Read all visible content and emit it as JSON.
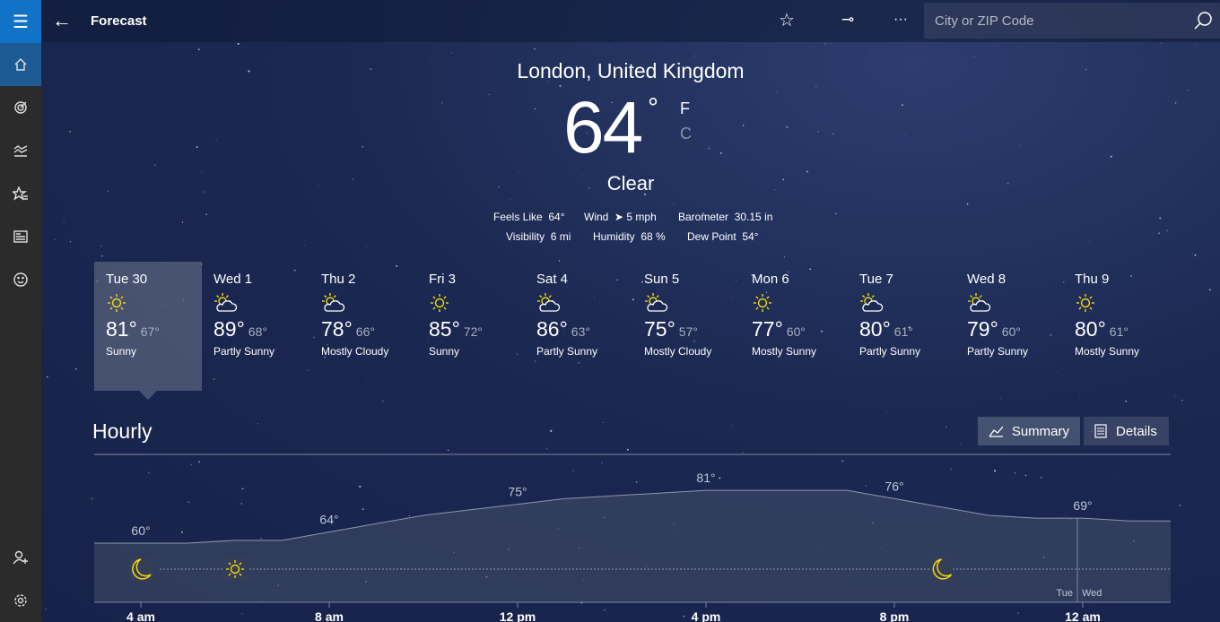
{
  "app": {
    "title": "Forecast",
    "search_placeholder": "City or ZIP Code"
  },
  "sidebar": {
    "items": [
      "menu-icon",
      "home-icon",
      "radar-icon",
      "historical-icon",
      "favorites-icon",
      "news-icon",
      "feedback-icon",
      "account-icon",
      "settings-icon"
    ]
  },
  "current": {
    "location": "London, United Kingdom",
    "temp": "64",
    "deg": "°",
    "unit_f": "F",
    "unit_c": "C",
    "condition": "Clear",
    "details": [
      {
        "label": "Feels Like",
        "value": "64°"
      },
      {
        "label": "Wind",
        "value": "5 mph"
      },
      {
        "label": "Barometer",
        "value": "30.15 in"
      },
      {
        "label": "Visibility",
        "value": "6 mi"
      },
      {
        "label": "Humidity",
        "value": "68 %"
      },
      {
        "label": "Dew Point",
        "value": "54°"
      }
    ]
  },
  "daily": [
    {
      "day": "Tue 30",
      "hi": "81°",
      "lo": "67°",
      "cond": "Sunny",
      "icon": "sun"
    },
    {
      "day": "Wed 1",
      "hi": "89°",
      "lo": "68°",
      "cond": "Partly Sunny",
      "icon": "partly"
    },
    {
      "day": "Thu 2",
      "hi": "78°",
      "lo": "66°",
      "cond": "Mostly Cloudy",
      "icon": "partly"
    },
    {
      "day": "Fri 3",
      "hi": "85°",
      "lo": "72°",
      "cond": "Sunny",
      "icon": "sun"
    },
    {
      "day": "Sat 4",
      "hi": "86°",
      "lo": "63°",
      "cond": "Partly Sunny",
      "icon": "partly"
    },
    {
      "day": "Sun 5",
      "hi": "75°",
      "lo": "57°",
      "cond": "Mostly Cloudy",
      "icon": "partly"
    },
    {
      "day": "Mon 6",
      "hi": "77°",
      "lo": "60°",
      "cond": "Mostly Sunny",
      "icon": "sun"
    },
    {
      "day": "Tue 7",
      "hi": "80°",
      "lo": "61°",
      "cond": "Partly Sunny",
      "icon": "partly"
    },
    {
      "day": "Wed 8",
      "hi": "79°",
      "lo": "60°",
      "cond": "Partly Sunny",
      "icon": "partly"
    },
    {
      "day": "Thu 9",
      "hi": "80°",
      "lo": "61°",
      "cond": "Mostly Sunny",
      "icon": "sun"
    }
  ],
  "hourly": {
    "title": "Hourly",
    "summary_label": "Summary",
    "details_label": "Details",
    "day_left": "Tue",
    "day_right": "Wed",
    "temp_labels": [
      {
        "hour": 4,
        "text": "60°"
      },
      {
        "hour": 8,
        "text": "64°"
      },
      {
        "hour": 12,
        "text": "75°"
      },
      {
        "hour": 16,
        "text": "81°"
      },
      {
        "hour": 20,
        "text": "76°"
      },
      {
        "hour": 24,
        "text": "69°"
      }
    ],
    "time_labels": [
      {
        "hour": 4,
        "text": "4 am"
      },
      {
        "hour": 8,
        "text": "8 am"
      },
      {
        "hour": 12,
        "text": "12 pm"
      },
      {
        "hour": 16,
        "text": "4 pm"
      },
      {
        "hour": 20,
        "text": "8 pm"
      },
      {
        "hour": 24,
        "text": "12 am"
      }
    ]
  },
  "chart_data": {
    "type": "area",
    "x_hours": [
      3,
      4,
      5,
      6,
      7,
      8,
      9,
      10,
      11,
      12,
      13,
      14,
      15,
      16,
      17,
      18,
      19,
      20,
      21,
      22,
      23,
      24,
      25,
      26
    ],
    "values": [
      60,
      60,
      60,
      61,
      61,
      64,
      67,
      70,
      72,
      74,
      76,
      77,
      78,
      79,
      79,
      79,
      79,
      76,
      73,
      70,
      69,
      69,
      68,
      68
    ],
    "icons": [
      {
        "hour": 4,
        "icon": "moon"
      },
      {
        "hour": 6,
        "icon": "sun"
      },
      {
        "hour": 21,
        "icon": "moon"
      }
    ]
  },
  "colors": {
    "accent": "#1173c7",
    "icon_yellow": "#f5d90a"
  }
}
